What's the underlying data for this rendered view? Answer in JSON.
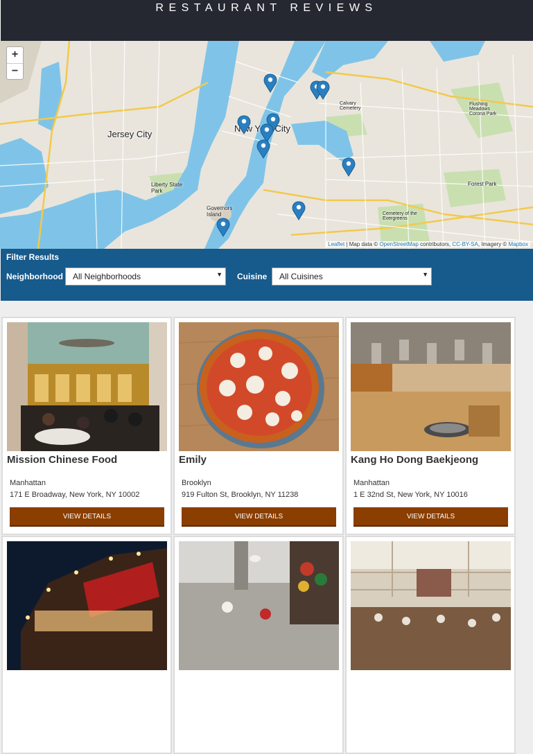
{
  "header": {
    "title": "RESTAURANT REVIEWS"
  },
  "map": {
    "zoom_in": "+",
    "zoom_out": "−",
    "labels": {
      "jersey_city": "Jersey City",
      "new_york_city": "New York City",
      "liberty_park": "Liberty State Park",
      "governors_island": "Governors Island",
      "forest_park": "Forest Park",
      "flushing": "Flushing Meadows Corona Park",
      "calvary": "Calvary Cemetery",
      "evergreens": "Cemetery of the Evergreens"
    },
    "attribution": {
      "leaflet": "Leaflet",
      "text1": " | Map data © ",
      "osm": "OpenStreetMap",
      "text2": " contributors, ",
      "cc": "CC-BY-SA",
      "text3": ", Imagery © ",
      "mapbox": "Mapbox"
    },
    "marker_color": "#2a7fc0"
  },
  "filter": {
    "title": "Filter Results",
    "neighborhood_label": "Neighborhood",
    "neighborhood_value": "All Neighborhoods",
    "cuisine_label": "Cuisine",
    "cuisine_value": "All Cuisines"
  },
  "restaurants": [
    {
      "name": "Mission Chinese Food",
      "neighborhood": "Manhattan",
      "address": "171 E Broadway, New York, NY 10002",
      "button": "VIEW DETAILS"
    },
    {
      "name": "Emily",
      "neighborhood": "Brooklyn",
      "address": "919 Fulton St, Brooklyn, NY 11238",
      "button": "VIEW DETAILS"
    },
    {
      "name": "Kang Ho Dong Baekjeong",
      "neighborhood": "Manhattan",
      "address": "1 E 32nd St, New York, NY 10016",
      "button": "VIEW DETAILS"
    },
    {
      "name": "",
      "neighborhood": "",
      "address": "",
      "button": ""
    },
    {
      "name": "",
      "neighborhood": "",
      "address": "",
      "button": ""
    },
    {
      "name": "",
      "neighborhood": "",
      "address": "",
      "button": ""
    }
  ],
  "colors": {
    "header_bg": "#252831",
    "filter_bg": "#175a8c",
    "button_bg": "#8a3e00",
    "water": "#7fc4e8",
    "land": "#e9e5dc"
  }
}
